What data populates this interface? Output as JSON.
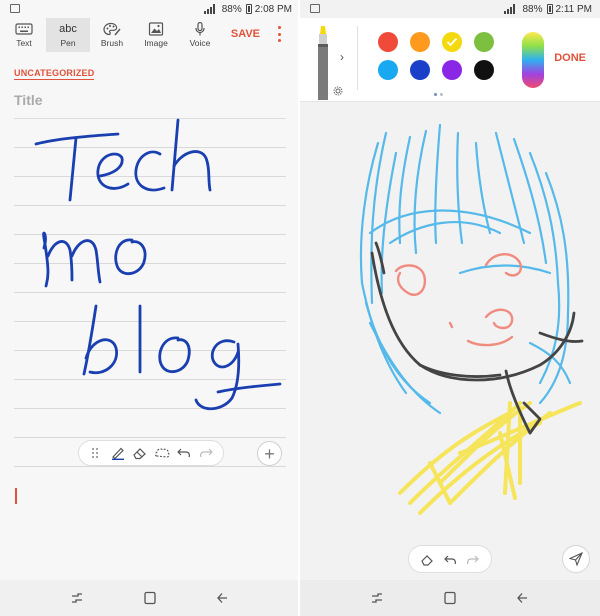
{
  "left": {
    "status": {
      "battery": "88%",
      "time": "2:08 PM"
    },
    "toolbar": {
      "tools": [
        {
          "label": "Text",
          "icon": "keyboard-icon"
        },
        {
          "label": "Pen",
          "icon": "abc",
          "active": true
        },
        {
          "label": "Brush",
          "icon": "palette-icon"
        },
        {
          "label": "Image",
          "icon": "image-icon"
        },
        {
          "label": "Voice",
          "icon": "microphone-icon"
        }
      ],
      "save_label": "SAVE"
    },
    "category": "UNCATEGORIZED",
    "title_placeholder": "Title",
    "handwriting_color": "#1a3fb0",
    "accent": "#e0533a"
  },
  "right": {
    "status": {
      "battery": "88%",
      "time": "2:11 PM"
    },
    "done_label": "DONE",
    "colors": [
      "#f04a3b",
      "#ff9a1f",
      "#f5d90f",
      "#7dc040",
      "#18a9f1",
      "#1a3fc9",
      "#8a27e6",
      "#111111"
    ],
    "selected_color": "#f5d90f"
  }
}
